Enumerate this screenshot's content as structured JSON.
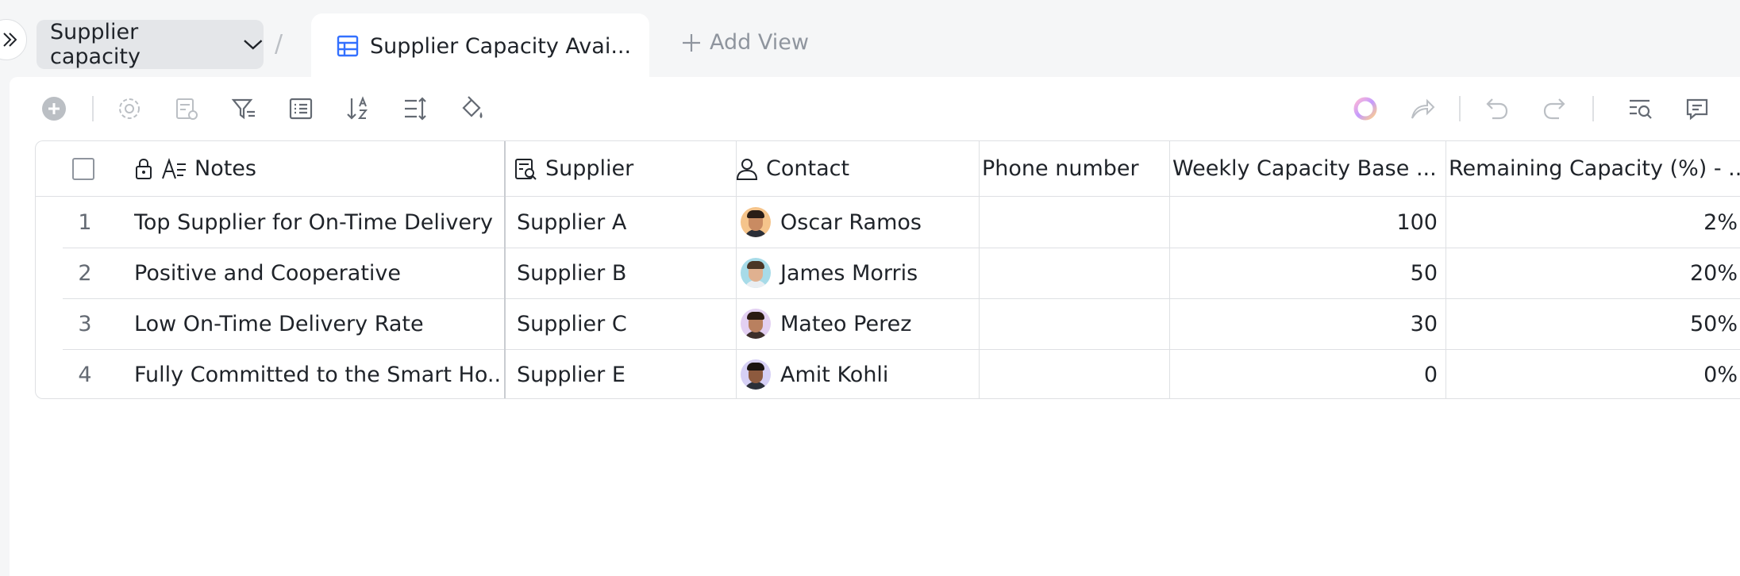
{
  "breadcrumb": {
    "base_name": "Supplier capacity"
  },
  "view_tab": {
    "label": "Supplier Capacity Avai..."
  },
  "add_view": {
    "label": "Add View"
  },
  "toolbar": {
    "left_icons": [
      "add-record-icon",
      "settings-icon",
      "field-settings-icon",
      "filter-icon",
      "group-icon",
      "sort-icon",
      "row-height-icon",
      "fill-color-icon"
    ],
    "right_icons": [
      "ai-assistant-icon",
      "share-icon",
      "undo-icon",
      "redo-icon",
      "search-icon",
      "comment-icon"
    ]
  },
  "table": {
    "columns": [
      {
        "label": "Notes"
      },
      {
        "label": "Supplier"
      },
      {
        "label": "Contact"
      },
      {
        "label": "Phone number"
      },
      {
        "label": "Weekly Capacity Base ..."
      },
      {
        "label": "Remaining Capacity (%) - ..."
      }
    ],
    "rows": [
      {
        "index": "1",
        "notes": "Top Supplier for On-Time Delivery",
        "supplier": "Supplier A",
        "contact": "Oscar Ramos",
        "phone": "",
        "weekly": "100",
        "remaining": "2%"
      },
      {
        "index": "2",
        "notes": "Positive and Cooperative",
        "supplier": "Supplier B",
        "contact": "James Morris",
        "phone": "",
        "weekly": "50",
        "remaining": "20%"
      },
      {
        "index": "3",
        "notes": "Low On-Time Delivery Rate",
        "supplier": "Supplier C",
        "contact": "Mateo Perez",
        "phone": "",
        "weekly": "30",
        "remaining": "50%"
      },
      {
        "index": "4",
        "notes": "Fully Committed to the Smart Ho...",
        "supplier": "Supplier E",
        "contact": "Amit Kohli",
        "phone": "",
        "weekly": "0",
        "remaining": "0%"
      }
    ]
  },
  "colors": {
    "accent": "#3370ff",
    "border": "#dee0e3",
    "muted_icon": "#8f959e"
  }
}
